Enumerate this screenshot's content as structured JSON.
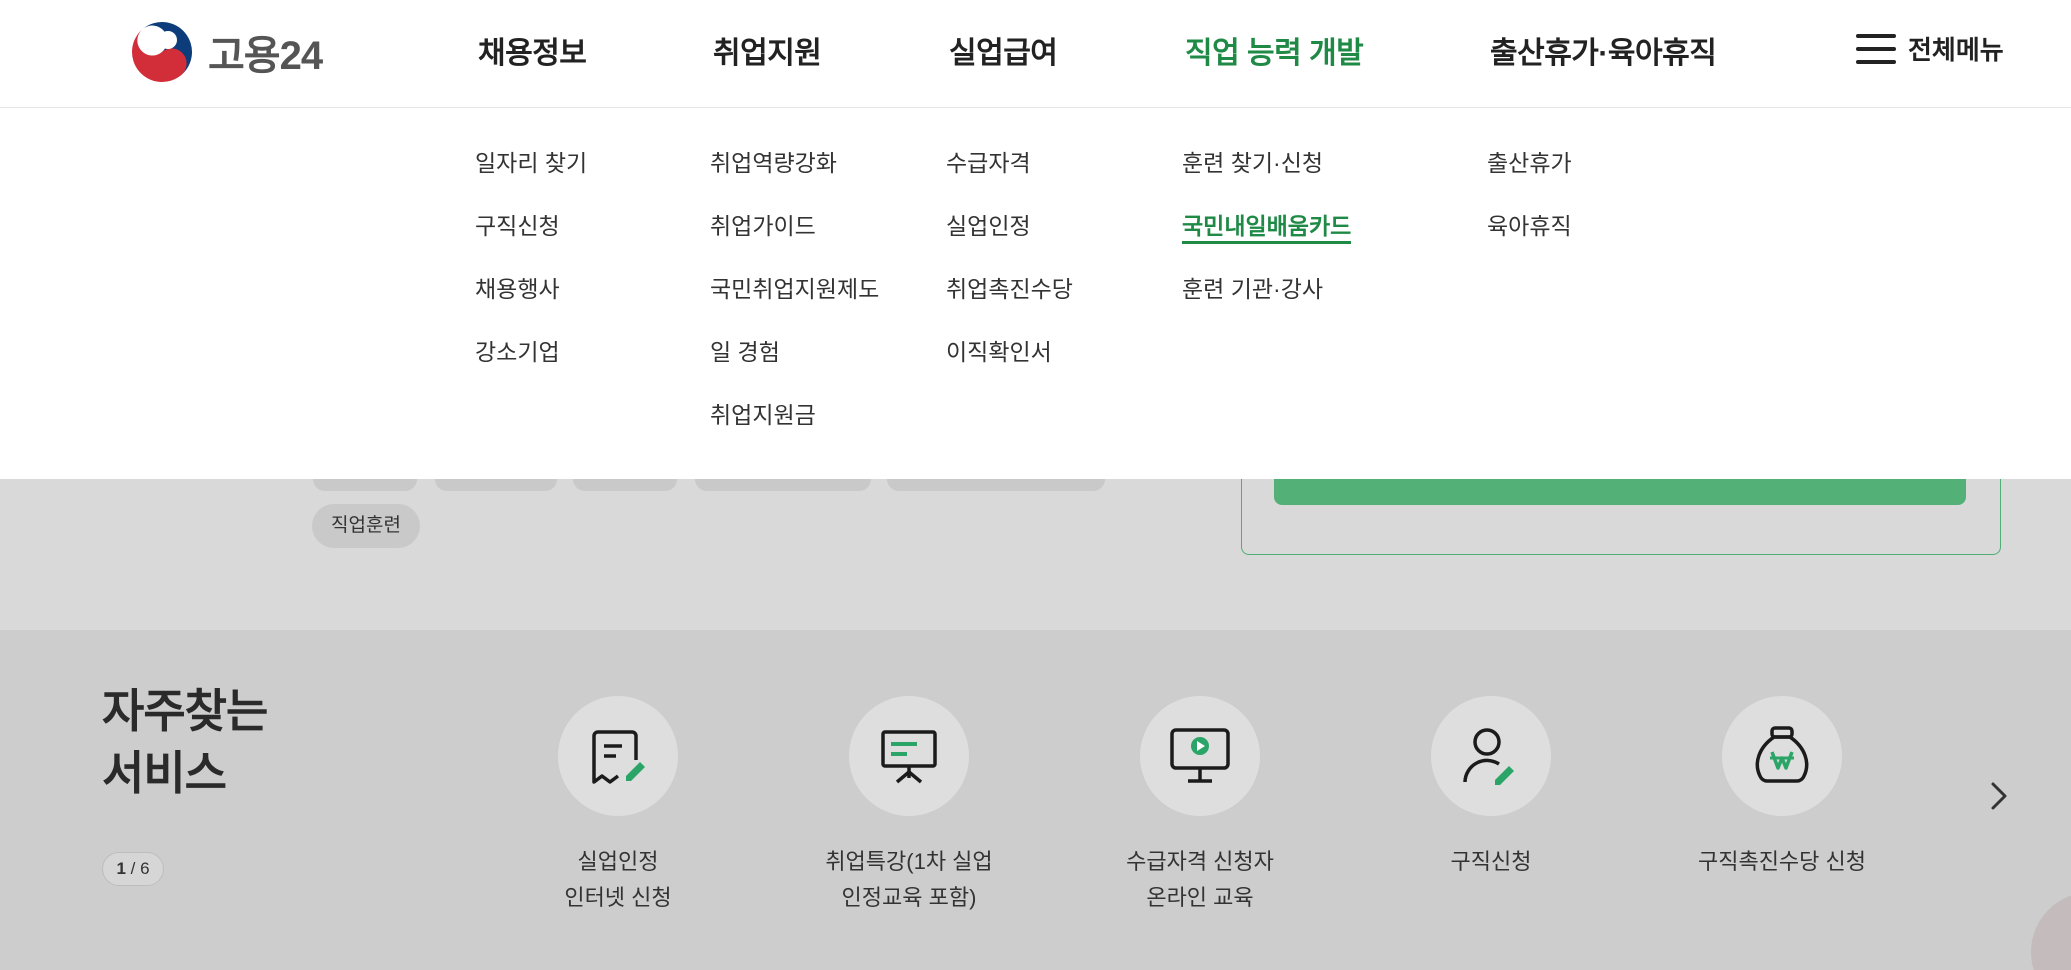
{
  "header": {
    "logo_text": "고용24",
    "nav": [
      {
        "label": "채용정보"
      },
      {
        "label": "취업지원"
      },
      {
        "label": "실업급여"
      },
      {
        "label": "직업 능력 개발"
      },
      {
        "label": "출산휴가·육아휴직"
      }
    ],
    "active_nav_index": 3,
    "all_menu_label": "전체메뉴"
  },
  "mega_menu": {
    "columns": [
      {
        "items": [
          "일자리 찾기",
          "구직신청",
          "채용행사",
          "강소기업"
        ]
      },
      {
        "items": [
          "취업역량강화",
          "취업가이드",
          "국민취업지원제도",
          "일 경험",
          "취업지원금"
        ]
      },
      {
        "items": [
          "수급자격",
          "실업인정",
          "취업촉진수당",
          "이직확인서"
        ]
      },
      {
        "items": [
          "훈련 찾기·신청",
          "국민내일배움카드",
          "훈련 기관·강사"
        ]
      },
      {
        "items": [
          "출산휴가",
          "육아휴직"
        ]
      }
    ],
    "active_item": "국민내일배움카드"
  },
  "tags": {
    "visible": [
      "직업훈련"
    ]
  },
  "frequent_services": {
    "title_line1": "자주찾는",
    "title_line2": "서비스",
    "pager_current": "1",
    "pager_sep": " / ",
    "pager_total": "6",
    "items": [
      {
        "line1": "실업인정",
        "line2": "인터넷 신청",
        "icon": "document-edit-icon"
      },
      {
        "line1": "취업특강(1차 실업",
        "line2": "인정교육 포함)",
        "icon": "presentation-board-icon"
      },
      {
        "line1": "수급자격 신청자",
        "line2": "온라인 교육",
        "icon": "monitor-play-icon"
      },
      {
        "line1": "구직신청",
        "line2": "",
        "icon": "person-edit-icon"
      },
      {
        "line1": "구직촉진수당 신청",
        "line2": "",
        "icon": "money-bag-won-icon"
      }
    ]
  },
  "colors": {
    "accent_green": "#1f8a46",
    "button_green": "#53b177",
    "icon_green": "#2aa567"
  }
}
